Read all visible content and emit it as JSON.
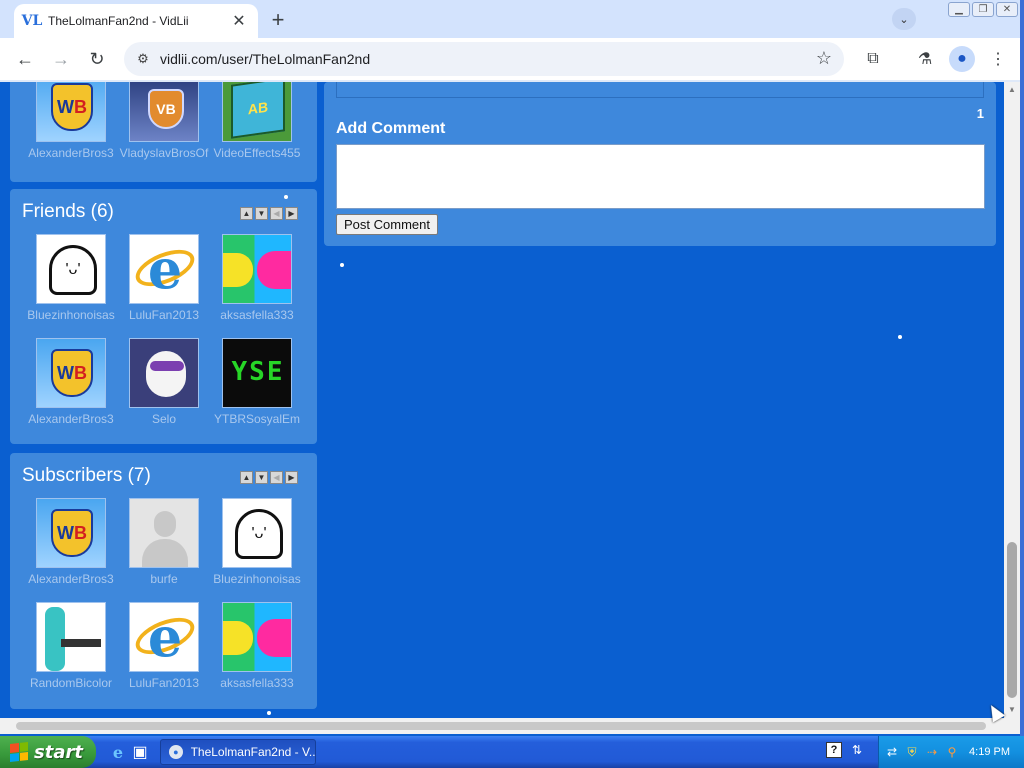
{
  "browser": {
    "tab_title": "TheLolmanFan2nd - VidLii",
    "tab_favicon": "VL",
    "url": "vidlii.com/user/TheLolmanFan2nd"
  },
  "top_panel": {
    "users": [
      {
        "name": "AlexanderBros3",
        "avatar": "wb"
      },
      {
        "name": "VladyslavBrosOf",
        "avatar": "vlad"
      },
      {
        "name": "VideoEffects455",
        "avatar": "box"
      }
    ]
  },
  "friends": {
    "title": "Friends (6)",
    "users": [
      {
        "name": "Bluezinhonoisas",
        "avatar": "blob"
      },
      {
        "name": "LuluFan2013",
        "avatar": "ie"
      },
      {
        "name": "aksasfella333",
        "avatar": "aks"
      },
      {
        "name": "AlexanderBros3",
        "avatar": "wb"
      },
      {
        "name": "Selo",
        "avatar": "selo"
      },
      {
        "name": "YTBRSosyalEm",
        "avatar": "yse"
      }
    ]
  },
  "subscribers": {
    "title": "Subscribers (7)",
    "users": [
      {
        "name": "AlexanderBros3",
        "avatar": "wb"
      },
      {
        "name": "burfe",
        "avatar": "blank"
      },
      {
        "name": "Bluezinhonoisas",
        "avatar": "blob"
      },
      {
        "name": "RandomBicolor",
        "avatar": "miku"
      },
      {
        "name": "LuluFan2013",
        "avatar": "ie"
      },
      {
        "name": "aksasfella333",
        "avatar": "aks"
      }
    ]
  },
  "comments": {
    "count": "1",
    "add_comment_label": "Add Comment",
    "comment_value": "",
    "post_button_label": "Post Comment"
  },
  "taskbar": {
    "start_label": "start",
    "task_label": "TheLolmanFan2nd - V...",
    "clock": "4:19 PM"
  },
  "avatar_text": {
    "yse": "YSE"
  },
  "colors": {
    "page_background": "#0a5fd0",
    "panel": "#3e88dc",
    "username": "#a9c8ee"
  }
}
